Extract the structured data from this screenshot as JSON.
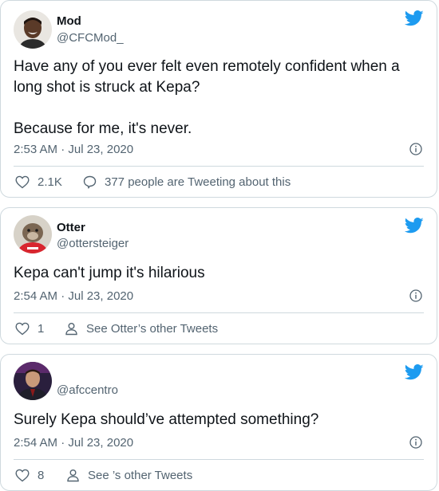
{
  "tweets": [
    {
      "name": "Mod",
      "handle": "@CFCMod_",
      "text": "Have any of you ever felt even remotely confident when a long shot is struck at Kepa?\n\nBecause for me, it's never.",
      "timestamp": "2:53 AM · Jul 23, 2020",
      "likes": "2.1K",
      "secondary_action": "377 people are Tweeting about this",
      "avatar_icon": "person-avatar",
      "brand_color": "#1d9bf0"
    },
    {
      "name": "Otter",
      "handle": "@ottersteiger",
      "text": "Kepa can't jump it's hilarious",
      "timestamp": "2:54 AM · Jul 23, 2020",
      "likes": "1",
      "secondary_action": "See Otter’s other Tweets",
      "avatar_icon": "otter-avatar",
      "brand_color": "#1d9bf0"
    },
    {
      "name": "",
      "handle": "@afccentro",
      "text": "Surely Kepa should’ve attempted something?",
      "timestamp": "2:54 AM · Jul 23, 2020",
      "likes": "8",
      "secondary_action": "See ’s other Tweets",
      "avatar_icon": "person-avatar",
      "brand_color": "#1d9bf0"
    }
  ]
}
